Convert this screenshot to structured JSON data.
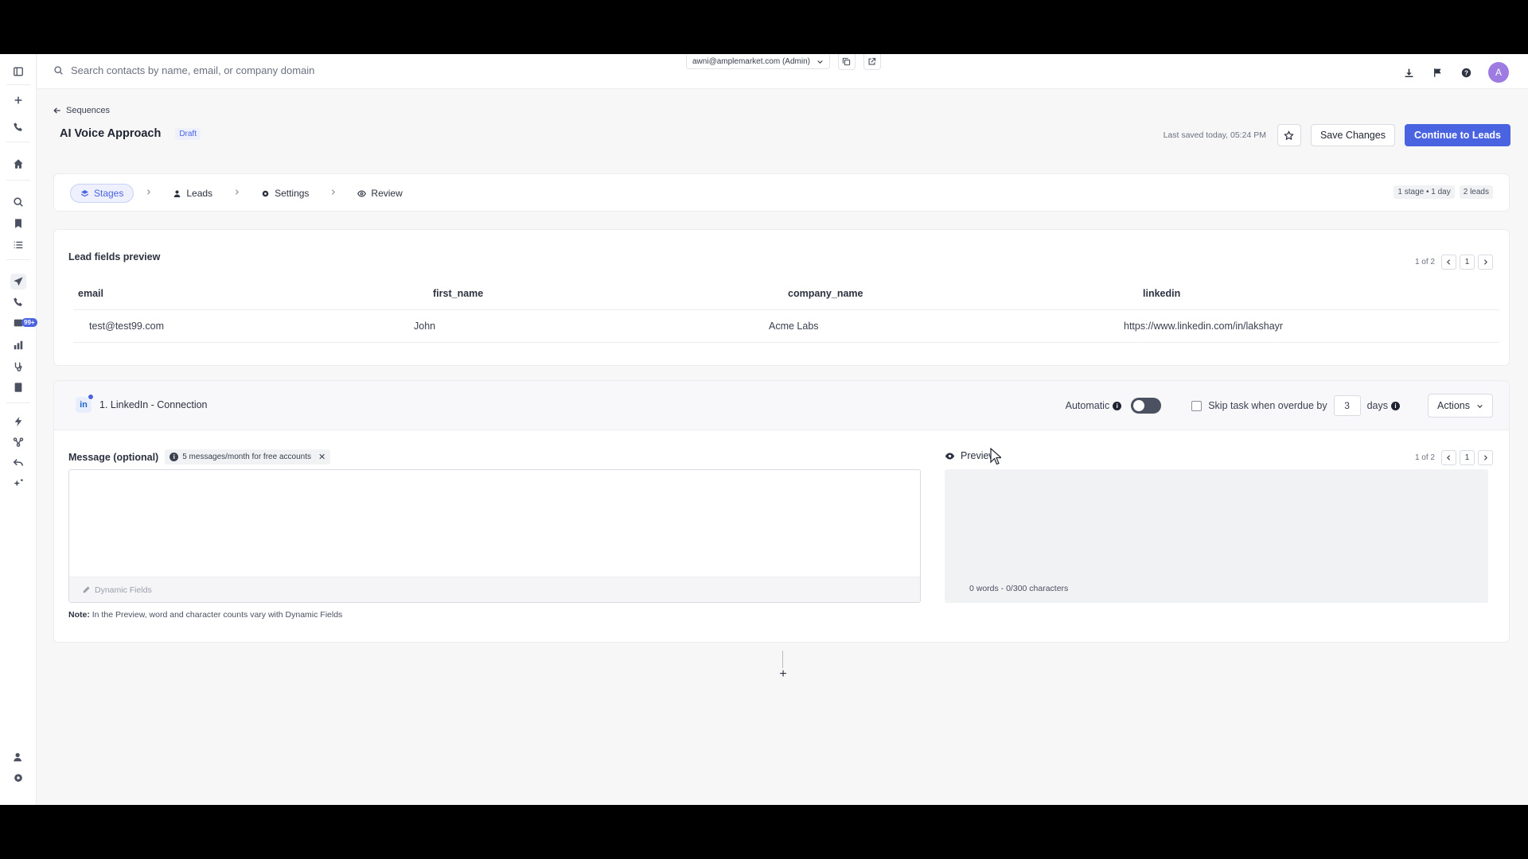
{
  "topbar": {
    "search_placeholder": "Search contacts by name, email, or company domain",
    "account": "awni@amplemarket.com (Admin)",
    "avatar_initial": "A"
  },
  "header": {
    "back_label": "Sequences",
    "title": "AI Voice Approach",
    "status": "Draft",
    "last_saved": "Last saved today, 05:24 PM",
    "save_label": "Save Changes",
    "continue_label": "Continue to Leads"
  },
  "steps": {
    "items": [
      {
        "label": "Stages",
        "active": true
      },
      {
        "label": "Leads"
      },
      {
        "label": "Settings"
      },
      {
        "label": "Review"
      }
    ],
    "meta_stages": "1 stage • 1 day",
    "meta_leads": "2 leads"
  },
  "lead_fields": {
    "title": "Lead fields preview",
    "pager_text": "1 of 2",
    "page": "1",
    "columns": [
      "email",
      "first_name",
      "company_name",
      "linkedin"
    ],
    "row": [
      "test@test99.com",
      "John",
      "Acme Labs",
      "https://www.linkedin.com/in/lakshayr"
    ]
  },
  "linkedin_step": {
    "logo": "in",
    "title": "1. LinkedIn - Connection",
    "automatic_label": "Automatic",
    "skip_label": "Skip task when overdue by",
    "skip_days": "3",
    "days_label": "days",
    "actions_label": "Actions",
    "message_label": "Message (optional)",
    "limit_text": "5 messages/month for free accounts",
    "dynamic_fields_label": "Dynamic Fields",
    "note_bold": "Note:",
    "note_text": " In the Preview, word and character counts vary with Dynamic Fields",
    "preview_label": "Preview",
    "preview_pager": "1 of 2",
    "preview_page": "1",
    "preview_count": "0 words - 0/300 characters"
  },
  "colors": {
    "accent": "#4a63e0",
    "linkedin": "#1b67c9",
    "avatar": "#9d7be0"
  }
}
